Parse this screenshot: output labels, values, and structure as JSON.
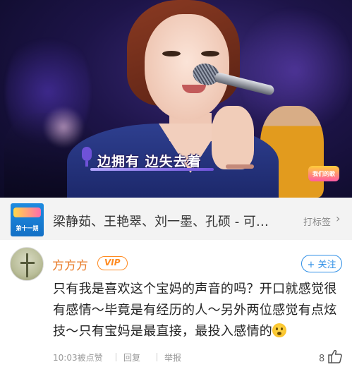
{
  "video": {
    "subtitle": "边拥有 边失去着",
    "badge_text": "我们的歌"
  },
  "link_card": {
    "thumb_text": "第十一期",
    "title": "梁静茹、王艳翠、刘一墨、孔硕 - 可…",
    "tag_label": "打标签",
    "arrow": "›"
  },
  "comment": {
    "username": "方方方",
    "vip_label": "VIP",
    "follow_label": "+ 关注",
    "text": "只有我是喜欢这个宝妈的声音的吗？开口就感觉很有感情～毕竟是有经历的人～另外两位感觉有点炫技～只有宝妈是最直接，最投入感情的",
    "time": "10:03被点赞",
    "reply_label": "回复",
    "report_label": "举报",
    "like_count": "8"
  },
  "colors": {
    "username": "#e87a26",
    "vip": "#ff8a1f",
    "follow": "#2f8fe6"
  },
  "icons": {
    "subtitle_mic": "microphone-icon",
    "like": "thumbs-up-icon",
    "arrow": "chevron-right-icon"
  }
}
